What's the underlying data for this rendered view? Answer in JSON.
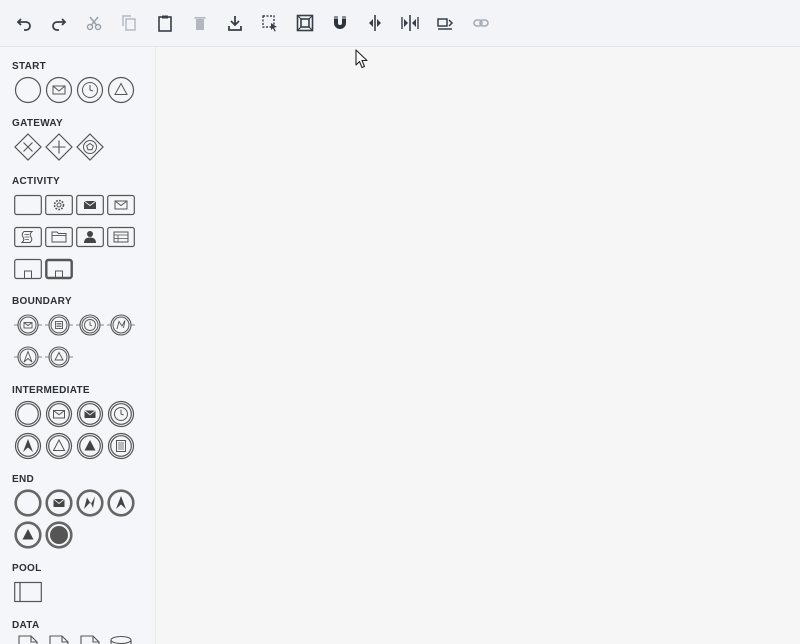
{
  "toolbar": {
    "buttons": [
      {
        "icon": "undo-icon"
      },
      {
        "icon": "redo-icon"
      },
      {
        "icon": "cut-icon"
      },
      {
        "icon": "copy-icon"
      },
      {
        "icon": "paste-icon"
      },
      {
        "icon": "delete-icon"
      },
      {
        "icon": "download-icon"
      },
      {
        "icon": "select-icon"
      },
      {
        "icon": "fit-icon"
      },
      {
        "icon": "snap-magnet-icon"
      },
      {
        "icon": "align-center-icon"
      },
      {
        "icon": "distribute-icon"
      },
      {
        "icon": "layout-icon"
      },
      {
        "icon": "link-icon"
      }
    ]
  },
  "sidebar": {
    "sections": {
      "start": "START",
      "gateway": "GATEWAY",
      "activity": "ACTIVITY",
      "boundary": "BOUNDARY",
      "intermediate": "INTERMEDIATE",
      "end": "END",
      "pool": "POOL",
      "data": "DATA"
    }
  },
  "colors": {
    "icon_stroke": "#5b5f66",
    "thick_stroke": "#666666",
    "toolbar_bg": "#f2f4f8",
    "canvas_bg": "#f7f6f6"
  }
}
